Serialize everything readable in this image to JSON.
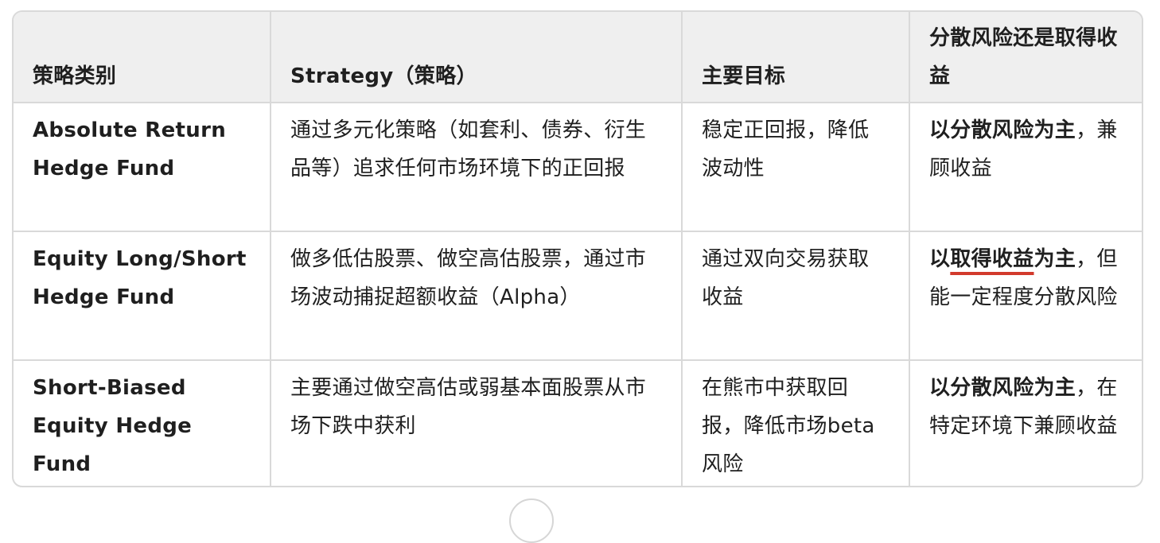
{
  "table": {
    "headers": [
      "策略类别",
      "Strategy（策略）",
      "主要目标",
      "分散风险还是取得收益"
    ],
    "rows": [
      {
        "category": "Absolute Return Hedge Fund",
        "strategy": "通过多元化策略（如套利、债券、衍生品等）追求任何市场环境下的正回报",
        "objective": "稳定正回报，降低波动性",
        "focus_bold": "以分散风险为主",
        "focus_rest": "，兼顾收益"
      },
      {
        "category": "Equity Long/Short Hedge Fund",
        "strategy": "做多低估股票、做空高估股票，通过市场波动捕捉超额收益（Alpha）",
        "objective": "通过双向交易获取收益",
        "focus_bold_pre": "以",
        "focus_bold_underlined": "取得收益",
        "focus_bold_post": "为主",
        "focus_rest": "，但能一定程度分散风险"
      },
      {
        "category": "Short-Biased Equity Hedge Fund",
        "strategy": "主要通过做空高估或弱基本面股票从市场下跌中获利",
        "objective": "在熊市中获取回报，降低市场beta风险",
        "focus_bold": "以分散风险为主",
        "focus_rest": "，在特定环境下兼顾收益"
      }
    ]
  },
  "colors": {
    "header_bg": "#efefef",
    "border": "#d9d9d9",
    "text": "#1f1f1f",
    "underline": "#d23a2c"
  },
  "icons": {
    "scroll_button": "scroll-down-button-circle"
  }
}
